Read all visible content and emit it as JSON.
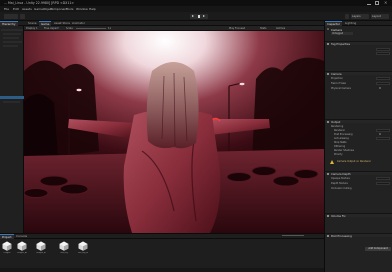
{
  "window": {
    "title": "... Mai_Lirua - Unity 22.9980] [RPD <DX11>",
    "controls": {
      "minimize": "",
      "maximize": "",
      "close": "✕"
    }
  },
  "menu": [
    "File",
    "Edit",
    "Assets",
    "GameObject",
    "Component",
    "Tools",
    "Window",
    "Help"
  ],
  "toolbar": {
    "account_label": "",
    "layers_label": "Layers",
    "layout_label": "Layout"
  },
  "scene_panel": {
    "tabs": [
      "Scene",
      "Game",
      "Asset Store",
      "Animator"
    ],
    "active_tab": 1,
    "game_bar": {
      "display": "Display 1",
      "aspect": "Free Aspect",
      "scale": "Scale",
      "scale_value": "1x",
      "play_focused": "Play Focused",
      "stats": "Stats",
      "gizmos": "Gizmos"
    }
  },
  "hierarchy": {
    "tab": "Hierarchy"
  },
  "inspector": {
    "tabs": [
      "Inspector",
      "Lighting"
    ],
    "object_name": "Camera",
    "tag": "Untagged",
    "sections": [
      {
        "name": "Tag Properties"
      },
      {
        "name": "Camera"
      },
      {
        "name": "Output"
      },
      {
        "name": "Camera Depth"
      },
      {
        "name": "Volume Fix"
      },
      {
        "name": "Post Processing"
      }
    ],
    "rows": {
      "projection": "Projection",
      "fov": "Field of View",
      "physical": "Physical Camera",
      "clipping": "Clipping Planes",
      "rendering": "Rendering",
      "renderer": "Renderer",
      "post": "Post Processing",
      "anti": "Anti-aliasing",
      "stop_nan": "Stop NaNs",
      "dither": "Dithering",
      "render_shadows": "Render Shadows",
      "priority": "Priority",
      "opaque": "Opaque Texture",
      "depth": "Depth Texture",
      "occlusion": "Occlusion Culling",
      "warning": "Camera Output on Renderer"
    },
    "add_component": "Add Component"
  },
  "project": {
    "tabs": [
      "Project",
      "Console"
    ],
    "assets": [
      "Dragon",
      "Dragon_Auto",
      "Dragon_Bl",
      "Mid_Rig",
      "Mid_Rig_Bl"
    ]
  },
  "colors": {
    "accent": "#3a79bb",
    "warning": "#e0b43a",
    "scene_tint": "#7a1822"
  }
}
